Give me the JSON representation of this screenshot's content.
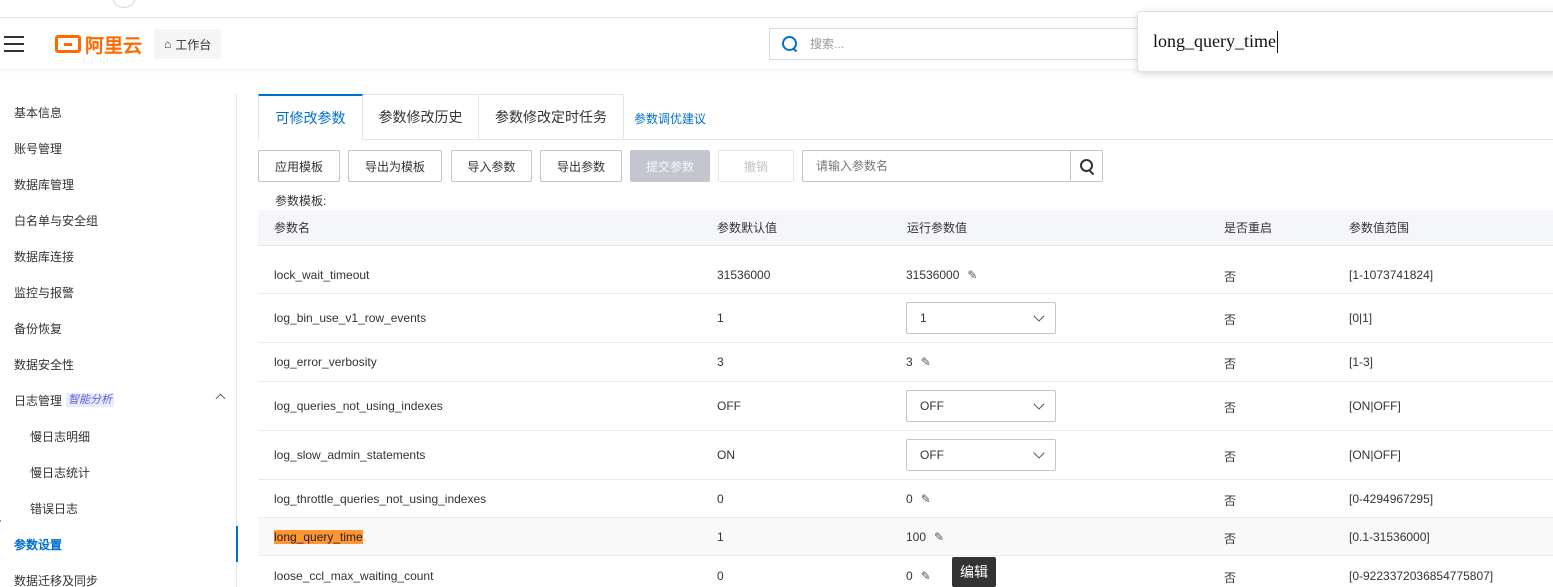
{
  "header": {
    "logo_text": "阿里云",
    "workbench_label": "工作台",
    "search_placeholder": "搜索..."
  },
  "find_overlay": {
    "text": "long_query_time"
  },
  "sidebar": {
    "items": [
      {
        "label": "基本信息"
      },
      {
        "label": "账号管理"
      },
      {
        "label": "数据库管理"
      },
      {
        "label": "白名单与安全组"
      },
      {
        "label": "数据库连接"
      },
      {
        "label": "监控与报警"
      },
      {
        "label": "备份恢复"
      },
      {
        "label": "数据安全性"
      },
      {
        "label": "日志管理",
        "tag": "智能分析"
      },
      {
        "label": "慢日志明细"
      },
      {
        "label": "慢日志统计"
      },
      {
        "label": "错误日志"
      },
      {
        "label": "参数设置"
      },
      {
        "label": "数据迁移及同步"
      }
    ]
  },
  "tabs": [
    {
      "label": "可修改参数"
    },
    {
      "label": "参数修改历史"
    },
    {
      "label": "参数修改定时任务"
    }
  ],
  "tab_link": "参数调优建议",
  "toolbar": {
    "apply_template": "应用模板",
    "export_template": "导出为模板",
    "import_params": "导入参数",
    "export_params": "导出参数",
    "submit_params": "提交参数",
    "cancel": "撤销",
    "search_placeholder": "请输入参数名"
  },
  "template_label": "参数模板:",
  "table": {
    "columns": [
      "参数名",
      "参数默认值",
      "运行参数值",
      "是否重启",
      "参数值范围"
    ],
    "rows": [
      {
        "name": "lock_wait_timeout",
        "default": "31536000",
        "value": "31536000",
        "restart": "否",
        "range": "[1-1073741824]"
      },
      {
        "name": "log_bin_use_v1_row_events",
        "default": "1",
        "value": "1",
        "restart": "否",
        "range": "[0|1]"
      },
      {
        "name": "log_error_verbosity",
        "default": "3",
        "value": "3",
        "restart": "否",
        "range": "[1-3]"
      },
      {
        "name": "log_queries_not_using_indexes",
        "default": "OFF",
        "value": "OFF",
        "restart": "否",
        "range": "[ON|OFF]"
      },
      {
        "name": "log_slow_admin_statements",
        "default": "ON",
        "value": "OFF",
        "restart": "否",
        "range": "[ON|OFF]"
      },
      {
        "name": "log_throttle_queries_not_using_indexes",
        "default": "0",
        "value": "0",
        "restart": "否",
        "range": "[0-4294967295]"
      },
      {
        "name": "long_query_time",
        "default": "1",
        "value": "100",
        "restart": "否",
        "range": "[0.1-31536000]"
      },
      {
        "name": "loose_ccl_max_waiting_count",
        "default": "0",
        "value": "0",
        "restart": "否",
        "range": "[0-9223372036854775807]"
      }
    ]
  },
  "tooltip": "编辑",
  "icons": {
    "edit": "pencil-icon",
    "dropdown": "chevron-down-icon",
    "search": "search-icon",
    "menu": "hamburger-icon",
    "home": "home-icon",
    "collapse": "chevron-up-icon"
  },
  "colors": {
    "brand": "#ff6a00",
    "accent": "#0070cc",
    "highlight": "#ff9632"
  }
}
